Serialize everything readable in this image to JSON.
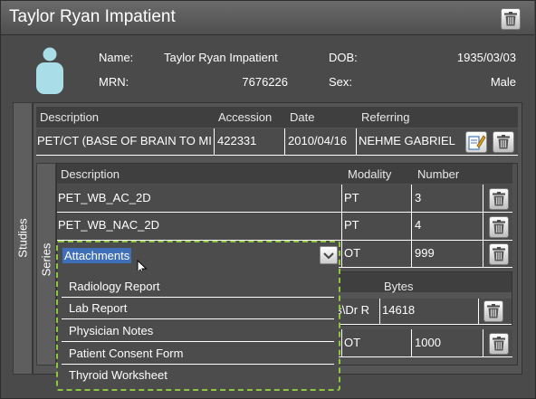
{
  "window": {
    "title": "Taylor Ryan Impatient"
  },
  "patient": {
    "name_label": "Name:",
    "name": "Taylor Ryan Impatient",
    "dob_label": "DOB:",
    "dob": "1935/03/03",
    "mrn_label": "MRN:",
    "mrn": "7676226",
    "sex_label": "Sex:",
    "sex": "Male"
  },
  "studies": {
    "tab_label": "Studies",
    "columns": [
      "Description",
      "Accession",
      "Date",
      "Referring"
    ],
    "rows": [
      {
        "description": "PET/CT (BASE OF BRAIN TO MID",
        "accession": "422331",
        "date": "2010/04/16",
        "referring": "NEHME GABRIEL"
      }
    ]
  },
  "series": {
    "tab_label": "Series",
    "columns": [
      "Description",
      "Modality",
      "Number"
    ],
    "rows": [
      {
        "description": "PET_WB_AC_2D",
        "modality": "PT",
        "number": "3"
      },
      {
        "description": "PET_WB_NAC_2D",
        "modality": "PT",
        "number": "4"
      },
      {
        "description": "",
        "modality": "OT",
        "number": "999"
      },
      {
        "description": "",
        "modality": "OT",
        "number": "1000"
      }
    ]
  },
  "attachments_sub": {
    "bytes_header": "Bytes",
    "row": {
      "path": "es\\Dr R",
      "bytes": "14618"
    }
  },
  "dropdown": {
    "selected": "Attachments",
    "options": [
      "Radiology Report",
      "Lab Report",
      "Physician Notes",
      "Patient Consent Form",
      "Thyroid Worksheet"
    ],
    "highlight_color": "#8ec63f"
  }
}
